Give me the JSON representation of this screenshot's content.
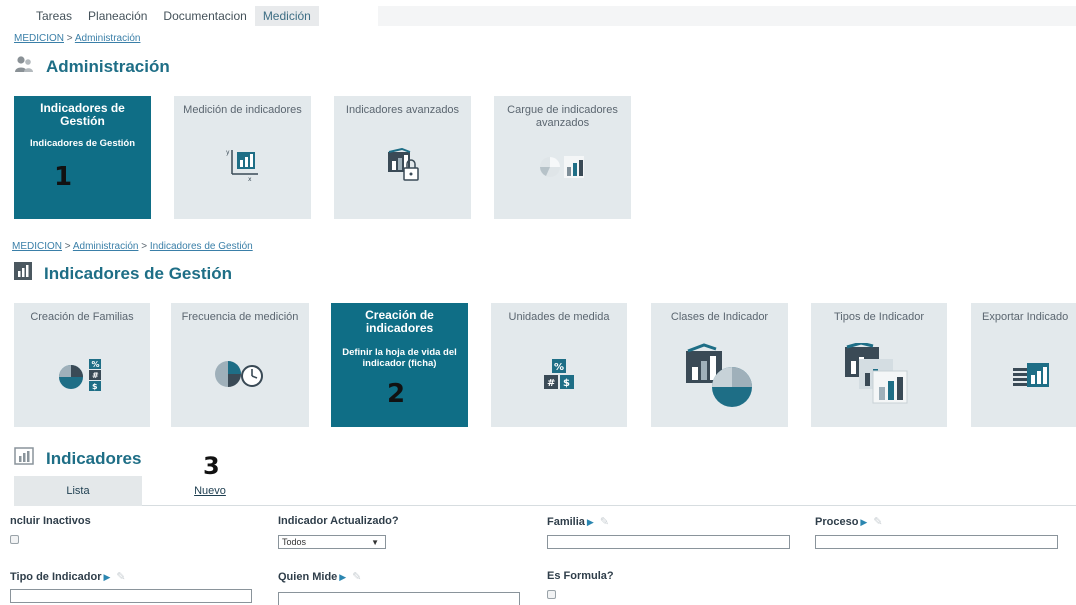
{
  "topnav": {
    "tabs": [
      "Tareas",
      "Planeación",
      "Documentacion",
      "Medición"
    ],
    "active_index": 3
  },
  "breadcrumb1": {
    "root": "MEDICION",
    "sep": ">",
    "current": "Administración"
  },
  "admin": {
    "title": "Administración",
    "tiles": [
      {
        "label": "Indicadores de Gestión",
        "sub": "Indicadores de Gestión",
        "marker": "1",
        "active": true
      },
      {
        "label": "Medición de indicadores",
        "icon": "axis-chart-icon"
      },
      {
        "label": "Indicadores avanzados",
        "icon": "locked-chart-icon"
      },
      {
        "label": "Cargue de indicadores avanzados",
        "icon": "pie-bar-icon"
      }
    ]
  },
  "breadcrumb2": {
    "root": "MEDICION",
    "sep": ">",
    "mid": "Administración",
    "current": "Indicadores de Gestión"
  },
  "gestion": {
    "title": "Indicadores de Gestión",
    "tiles": [
      {
        "label": "Creación de Familias",
        "icon": "pie-calc-icon"
      },
      {
        "label": "Frecuencia de medición",
        "icon": "pie-clock-icon"
      },
      {
        "label": "Creación de indicadores",
        "sub": "Definir la hoja de vida del indicador (ficha)",
        "marker": "2",
        "active": true
      },
      {
        "label": "Unidades de medida",
        "icon": "units-icon"
      },
      {
        "label": "Clases de Indicador",
        "icon": "bar-pie-icon"
      },
      {
        "label": "Tipos de Indicador",
        "icon": "stacked-charts-icon"
      },
      {
        "label": "Exportar Indicado",
        "icon": "export-chart-icon"
      }
    ]
  },
  "indicadores": {
    "title": "Indicadores",
    "marker": "3",
    "tabs": {
      "list": "Lista",
      "new": "Nuevo"
    }
  },
  "filters": {
    "incluir_inactivos": "ncluir Inactivos",
    "indicador_actualizado": "Indicador Actualizado?",
    "actualizado_value": "Todos",
    "familia": "Familia",
    "proceso": "Proceso",
    "tipo_indicador": "Tipo de Indicador",
    "quien_mide": "Quien Mide",
    "es_formula": "Es Formula?"
  },
  "colors": {
    "tile": "#e3e9ec",
    "tile_active": "#0f6e86",
    "title": "#1e6e86"
  }
}
